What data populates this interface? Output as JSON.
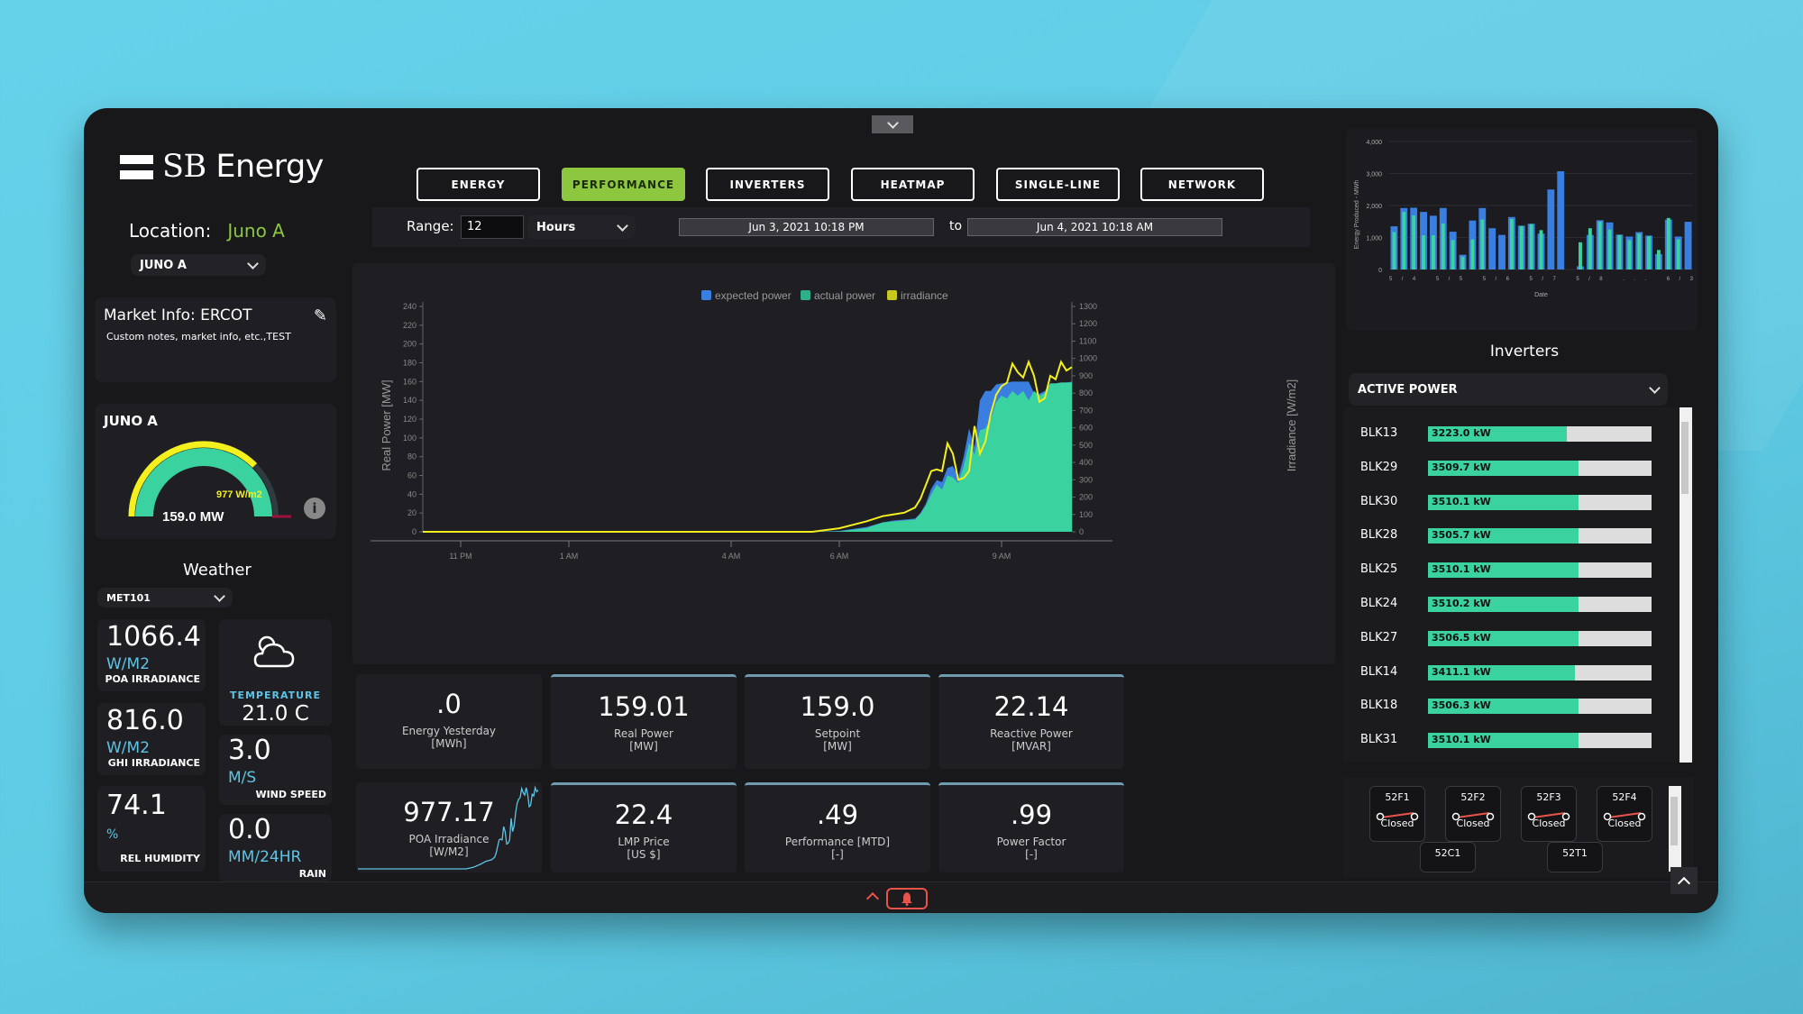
{
  "brand": {
    "name_a": "SB",
    "name_b": "Energy"
  },
  "location": {
    "label": "Location:",
    "value": "Juno A",
    "select": "JUNO A"
  },
  "market": {
    "title": "Market Info: ERCOT",
    "notes": "Custom notes, market info, etc.,TEST"
  },
  "gauge": {
    "title": "JUNO A",
    "power_label": "159.0 MW",
    "irradiance_label": "977 W/m2",
    "power_fraction": 0.66,
    "irradiance_fraction": 0.75
  },
  "weather": {
    "title": "Weather",
    "station": "MET101",
    "poa": {
      "value": "1066.4",
      "unit": "W/M2",
      "label": "POA IRRADIANCE"
    },
    "temperature": {
      "label": "TEMPERATURE",
      "value": "21.0 C"
    },
    "ghi": {
      "value": "816.0",
      "unit": "W/M2",
      "label": "GHI IRRADIANCE"
    },
    "wind": {
      "value": "3.0",
      "unit": "M/S",
      "label": "WIND SPEED"
    },
    "humidity": {
      "value": "74.1",
      "unit": "%",
      "label": "REL HUMIDITY"
    },
    "rain": {
      "value": "0.0",
      "unit": "MM/24HR",
      "label": "RAIN"
    }
  },
  "nav": {
    "tabs": [
      "ENERGY",
      "PERFORMANCE",
      "INVERTERS",
      "HEATMAP",
      "SINGLE-LINE",
      "NETWORK"
    ],
    "active": "PERFORMANCE"
  },
  "range": {
    "label": "Range:",
    "value": "12",
    "unit": "Hours",
    "from": "Jun 3, 2021 10:18 PM",
    "to_label": "to",
    "to": "Jun 4, 2021 10:18 AM"
  },
  "kpis": [
    {
      "value": ".0",
      "label": "Energy Yesterday",
      "unit": "[MWh]"
    },
    {
      "value": "159.01",
      "label": "Real Power",
      "unit": "[MW]"
    },
    {
      "value": "159.0",
      "label": "Setpoint",
      "unit": "[MW]"
    },
    {
      "value": "22.14",
      "label": "Reactive Power",
      "unit": "[MVAR]"
    },
    {
      "value": "977.17",
      "label": "POA Irradiance",
      "unit": "[W/M2]"
    },
    {
      "value": "22.4",
      "label": "LMP Price",
      "unit": "[US $]"
    },
    {
      "value": ".49",
      "label": "Performance [MTD]",
      "unit": "[-]"
    },
    {
      "value": ".99",
      "label": "Power Factor",
      "unit": "[-]"
    }
  ],
  "inverters": {
    "title": "Inverters",
    "metric": "ACTIVE POWER",
    "max_kw": 5200,
    "rows": [
      {
        "name": "BLK13",
        "value": "3223.0 kW",
        "kw": 3223.0
      },
      {
        "name": "BLK29",
        "value": "3509.7 kW",
        "kw": 3509.7
      },
      {
        "name": "BLK30",
        "value": "3510.1 kW",
        "kw": 3510.1
      },
      {
        "name": "BLK28",
        "value": "3505.7 kW",
        "kw": 3505.7
      },
      {
        "name": "BLK25",
        "value": "3510.1 kW",
        "kw": 3510.1
      },
      {
        "name": "BLK24",
        "value": "3510.2 kW",
        "kw": 3510.2
      },
      {
        "name": "BLK27",
        "value": "3506.5 kW",
        "kw": 3506.5
      },
      {
        "name": "BLK14",
        "value": "3411.1 kW",
        "kw": 3411.1
      },
      {
        "name": "BLK18",
        "value": "3506.3 kW",
        "kw": 3506.3
      },
      {
        "name": "BLK31",
        "value": "3510.1 kW",
        "kw": 3510.1
      }
    ]
  },
  "breakers": [
    {
      "name": "52F1",
      "state": "Closed"
    },
    {
      "name": "52F2",
      "state": "Closed"
    },
    {
      "name": "52F3",
      "state": "Closed"
    },
    {
      "name": "52F4",
      "state": "Closed"
    },
    {
      "name": "52C1",
      "state": ""
    },
    {
      "name": "52T1",
      "state": ""
    }
  ],
  "colors": {
    "accent": "#8dc63f",
    "actual": "#3ad29f",
    "expected": "#3a7fe0",
    "irradiance": "#e8e820",
    "alarm": "#e8534a",
    "unit": "#5ec4e6"
  },
  "chart_data": [
    {
      "type": "area",
      "title": "",
      "legend": [
        "expected power",
        "actual power",
        "irradiance"
      ],
      "legend_position": "top-center",
      "xlabel": "",
      "ylabel": "Real Power [MW]",
      "y2label": "Irradiance [W/m2]",
      "ylim": [
        0,
        240
      ],
      "y2lim": [
        0,
        1300
      ],
      "yticks": [
        0,
        20,
        40,
        60,
        80,
        100,
        120,
        140,
        160,
        180,
        200,
        220,
        240
      ],
      "y2ticks": [
        0,
        100,
        200,
        300,
        400,
        500,
        600,
        700,
        800,
        900,
        1000,
        1100,
        1200,
        1300
      ],
      "xlim_hours": [
        22.3,
        34.3
      ],
      "xticks": [
        {
          "h": 23,
          "label": "11 PM"
        },
        {
          "h": 25,
          "label": "1 AM"
        },
        {
          "h": 28,
          "label": "4 AM"
        },
        {
          "h": 30,
          "label": "6 AM"
        },
        {
          "h": 33,
          "label": "9 AM"
        }
      ],
      "x": [
        22.3,
        29.5,
        30.0,
        30.5,
        30.8,
        31.0,
        31.2,
        31.4,
        31.5,
        31.6,
        31.7,
        31.8,
        31.9,
        32.0,
        32.1,
        32.2,
        32.3,
        32.4,
        32.5,
        32.6,
        32.7,
        32.8,
        32.9,
        33.0,
        33.1,
        33.2,
        33.3,
        33.4,
        33.5,
        33.6,
        33.7,
        33.8,
        33.9,
        34.0,
        34.1,
        34.2,
        34.3
      ],
      "series": [
        {
          "name": "expected power",
          "values": [
            0,
            0,
            1,
            5,
            10,
            12,
            13,
            14,
            20,
            30,
            46,
            55,
            53,
            68,
            70,
            58,
            80,
            110,
            90,
            140,
            150,
            150,
            157,
            158,
            159,
            160,
            160,
            160,
            160,
            148,
            147,
            150,
            158,
            158,
            159,
            159,
            160
          ]
        },
        {
          "name": "actual power",
          "values": [
            0,
            0,
            0.5,
            4,
            10,
            11,
            12,
            13,
            19,
            28,
            40,
            50,
            45,
            60,
            58,
            52,
            70,
            95,
            82,
            108,
            110,
            120,
            138,
            145,
            142,
            150,
            145,
            150,
            140,
            150,
            145,
            148,
            158,
            158,
            159,
            159,
            159
          ]
        },
        {
          "name": "irradiance",
          "values": [
            0,
            0,
            20,
            60,
            90,
            100,
            110,
            140,
            190,
            270,
            350,
            360,
            350,
            510,
            450,
            300,
            310,
            350,
            610,
            450,
            520,
            680,
            790,
            840,
            860,
            970,
            920,
            890,
            980,
            900,
            750,
            770,
            900,
            880,
            980,
            930,
            950
          ]
        }
      ]
    },
    {
      "type": "bar",
      "title": "",
      "xlabel": "Date",
      "ylabel": "Energy Produced - MWh",
      "ylim": [
        0,
        4000
      ],
      "yticks": [
        0,
        1000,
        2000,
        3000,
        4000
      ],
      "categories_label": "5/4 5/5 5/6 5/7 5/8 ... 6/3",
      "series": [
        {
          "name": "expected",
          "values": [
            1350,
            1920,
            1930,
            1800,
            1680,
            1920,
            1180,
            460,
            1530,
            1920,
            1290,
            1080,
            1640,
            1370,
            1430,
            1120,
            2500,
            3070,
            0,
            100,
            1080,
            1540,
            1470,
            1090,
            1030,
            1170,
            1060,
            480,
            1560,
            1030,
            1490
          ]
        },
        {
          "name": "actual",
          "values": [
            1170,
            1800,
            1690,
            1070,
            1070,
            1440,
            920,
            400,
            940,
            1560,
            0,
            0,
            1580,
            1360,
            1420,
            1230,
            0,
            0,
            0,
            850,
            1290,
            1500,
            1250,
            1080,
            920,
            1120,
            1040,
            610,
            1610,
            940,
            0
          ]
        }
      ]
    }
  ]
}
